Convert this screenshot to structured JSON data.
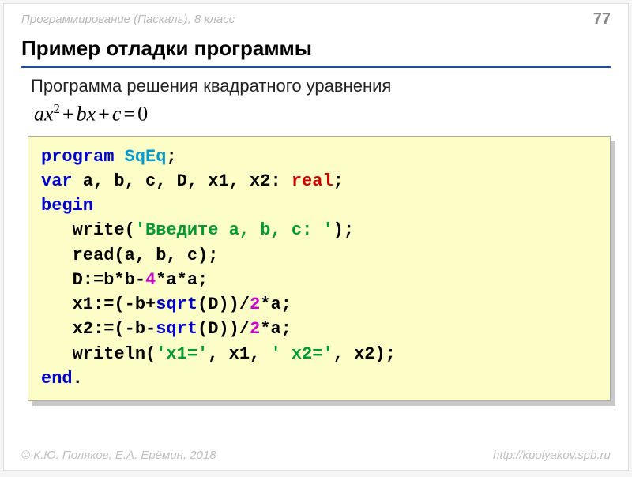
{
  "header": {
    "course": "Программирование (Паскаль), 8 класс",
    "page": "77"
  },
  "title": "Пример отладки программы",
  "subtitle": "Программа решения квадратного уравнения",
  "equation": {
    "a": "ax",
    "exp": "2",
    "b": "bx",
    "c": "c",
    "plus": "+",
    "eq": "=",
    "zero": "0"
  },
  "code": {
    "l1": {
      "kw_program": "program",
      "name": "SqEq",
      "semi": ";"
    },
    "l2": {
      "kw_var": "var",
      "vars": " a, b, c, D, x1, x2: ",
      "type": "real",
      "semi": ";"
    },
    "l3": {
      "kw_begin": "begin"
    },
    "l4": {
      "indent": "   write(",
      "str": "'Введите a, b, c: '",
      "rest": ");"
    },
    "l5": {
      "indent": "   read(a, b, c);"
    },
    "l6": {
      "indent": "   D:=b*b-",
      "num": "4",
      "rest": "*a*a;"
    },
    "l7": {
      "indent": "   x1:=(-b+",
      "fn": "sqrt",
      "mid": "(D))/",
      "num": "2",
      "rest": "*a;"
    },
    "l8": {
      "indent": "   x2:=(-b-",
      "fn": "sqrt",
      "mid": "(D))/",
      "num": "2",
      "rest": "*a;"
    },
    "l9": {
      "indent": "   writeln(",
      "s1": "'x1='",
      "m1": ", x1, ",
      "s2": "' x2='",
      "m2": ", x2);"
    },
    "l10": {
      "kw_end": "end",
      "dot": "."
    }
  },
  "footer": {
    "authors": "© К.Ю. Поляков, Е.А. Ерёмин, 2018",
    "url": "http://kpolyakov.spb.ru"
  }
}
